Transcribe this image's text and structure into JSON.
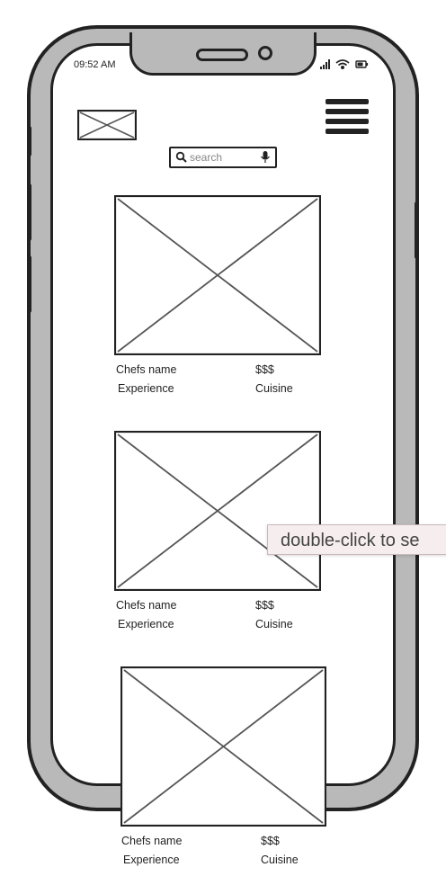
{
  "status_bar": {
    "time": "09:52 AM",
    "icons": [
      "signal-icon",
      "wifi-icon",
      "battery-icon"
    ]
  },
  "header": {
    "logo": "image-placeholder",
    "menu_icon": "hamburger-menu-icon"
  },
  "search": {
    "placeholder": "search",
    "icon": "search-icon",
    "mic_icon": "microphone-icon"
  },
  "chefs": [
    {
      "name": "Chefs name",
      "price": "$$$",
      "experience": "Experience",
      "cuisine": "Cuisine"
    },
    {
      "name": "Chefs name",
      "price": "$$$",
      "experience": "Experience",
      "cuisine": "Cuisine"
    },
    {
      "name": "Chefs name",
      "price": "$$$",
      "experience": "Experience",
      "cuisine": "Cuisine"
    }
  ],
  "tooltip": {
    "text": "double-click to se"
  },
  "colors": {
    "frame": "#b9b9b9",
    "stroke": "#222222",
    "tooltip_bg": "#f6edef"
  }
}
